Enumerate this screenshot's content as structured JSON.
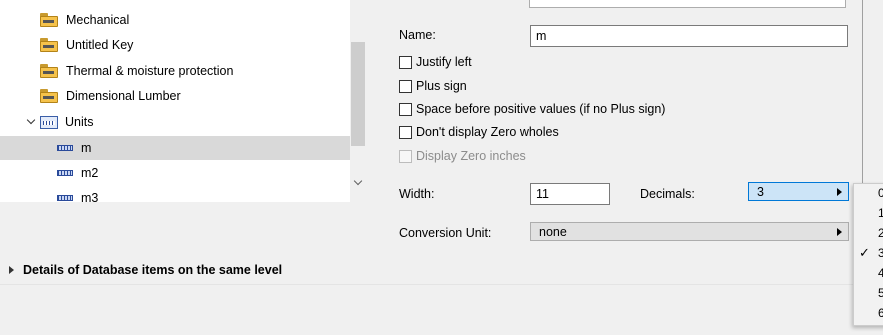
{
  "tree": {
    "items": [
      {
        "label": "Mechanical",
        "icon": "key-folder-icon"
      },
      {
        "label": "Untitled Key",
        "icon": "key-folder-icon"
      },
      {
        "label": "Thermal & moisture protection",
        "icon": "key-folder-icon"
      },
      {
        "label": "Dimensional Lumber",
        "icon": "key-folder-icon"
      },
      {
        "label": "Units",
        "icon": "units-folder-icon",
        "expanded": true
      },
      {
        "label": "m",
        "icon": "ruler-icon",
        "selected": true
      },
      {
        "label": "m2",
        "icon": "ruler-icon"
      },
      {
        "label": "m3",
        "icon": "ruler-icon"
      }
    ]
  },
  "details": {
    "title": "Details of Database items on the same level"
  },
  "props": {
    "name_label": "Name:",
    "name_value": "m",
    "checkboxes": [
      {
        "label": "Justify left",
        "checked": false,
        "enabled": true
      },
      {
        "label": "Plus sign",
        "checked": false,
        "enabled": true
      },
      {
        "label": "Space before positive values (if no Plus sign)",
        "checked": false,
        "enabled": true
      },
      {
        "label": "Don't display Zero wholes",
        "checked": false,
        "enabled": true
      },
      {
        "label": "Display Zero inches",
        "checked": false,
        "enabled": false
      }
    ],
    "width_label": "Width:",
    "width_value": "11",
    "decimals_label": "Decimals:",
    "decimals_value": "3",
    "conversion_label": "Conversion Unit:",
    "conversion_value": "none"
  },
  "decimals_menu": {
    "options": [
      "0",
      "1",
      "2",
      "3",
      "4",
      "5",
      "6"
    ],
    "checked": "3",
    "check_glyph": "✓"
  },
  "colors": {
    "selection": "#d9d9d9",
    "active_dropdown": "#cce4f7",
    "active_border": "#0078d7"
  }
}
